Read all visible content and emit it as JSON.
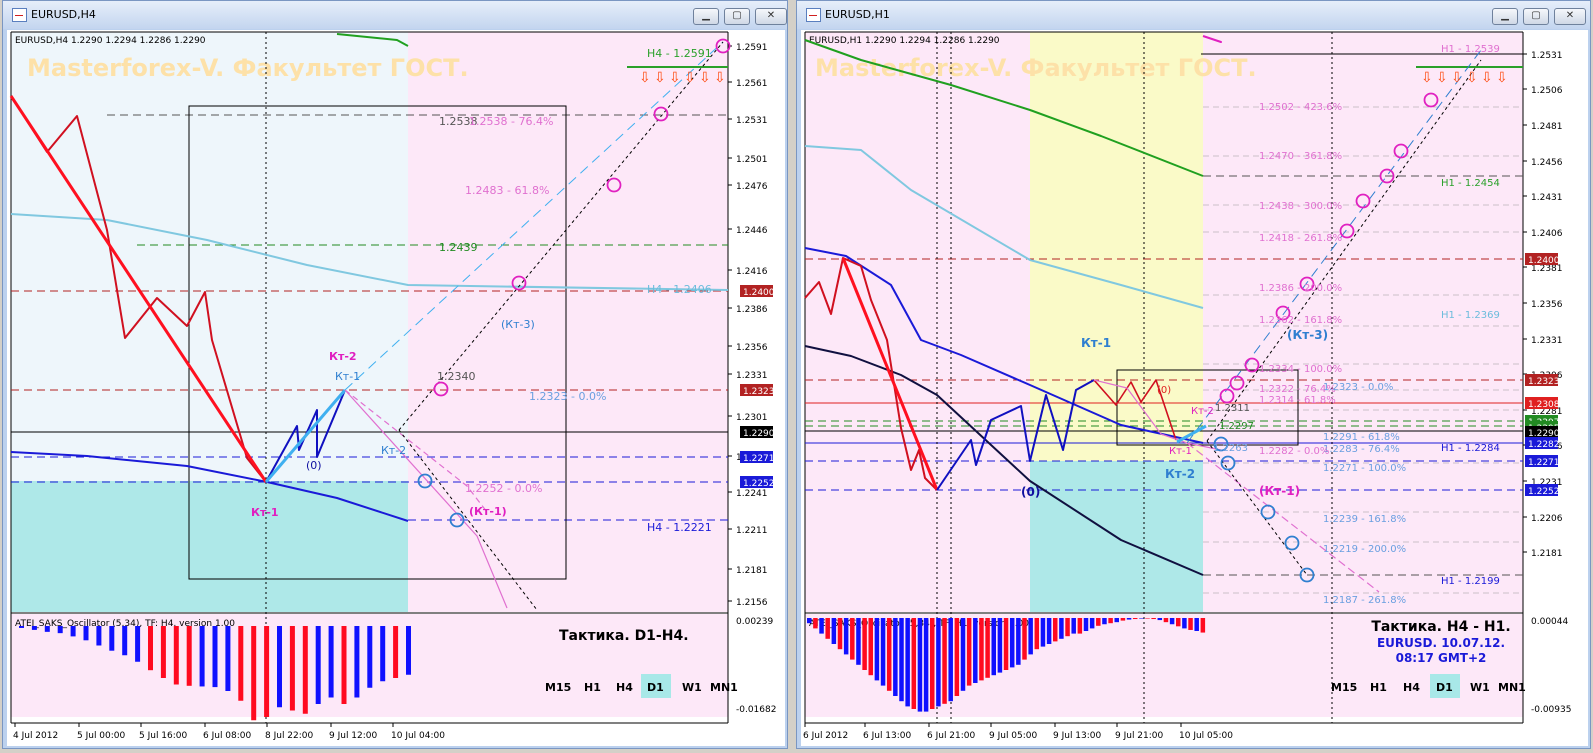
{
  "windows": [
    {
      "title": "EURUSD,H4",
      "info": "EURUSD,H4  1.2290 1.2294 1.2286 1.2290",
      "watermark": "Masterforex-V. Факультет ГОСТ.",
      "price_ticks": [
        "1.2591",
        "1.2561",
        "1.2531",
        "1.2501",
        "1.2476",
        "1.2446",
        "1.2416",
        "1.2386",
        "1.2356",
        "1.2331",
        "1.2301",
        "1.2271",
        "1.2241",
        "1.2211",
        "1.2181",
        "1.2156"
      ],
      "price_tags": [
        {
          "text": "1.2400",
          "color": "#b22222"
        },
        {
          "text": "1.2323",
          "color": "#b22222"
        },
        {
          "text": "1.2290",
          "color": "#000000"
        },
        {
          "text": "1.2271",
          "color": "#1a1ad8"
        },
        {
          "text": "1.2252",
          "color": "#1a1ad8"
        }
      ],
      "chart_labels": [
        {
          "key": "h4_2591",
          "text": "H4 - 1.2591",
          "color": "#2aa02a"
        },
        {
          "key": "l2538",
          "text": "1.2538",
          "color": "#555555"
        },
        {
          "key": "l2538f",
          "text": "1.2538 - 76.4%",
          "color": "#e070d0"
        },
        {
          "key": "l2483",
          "text": "1.2483 - 61.8%",
          "color": "#e070d0"
        },
        {
          "key": "l2439",
          "text": "1.2439",
          "color": "#228b22"
        },
        {
          "key": "h4_2406",
          "text": "H4 - 1.2406",
          "color": "#6cbcdc"
        },
        {
          "key": "kt3",
          "text": "(Кт-3)",
          "color": "#2f7fd0"
        },
        {
          "key": "kt2",
          "text": "Кт-2",
          "color": "#e020c0"
        },
        {
          "key": "kt1b",
          "text": "Кт-1",
          "color": "#2f7fd0"
        },
        {
          "key": "l2340",
          "text": "1.2340",
          "color": "#555555"
        },
        {
          "key": "l2323",
          "text": "1.2323 - 0.0%",
          "color": "#6a9fe0"
        },
        {
          "key": "kt2b",
          "text": "Кт-2",
          "color": "#2f7fd0"
        },
        {
          "key": "zero",
          "text": "(0)",
          "color": "#1010a0"
        },
        {
          "key": "l2252",
          "text": "1.2252 - 0.0%",
          "color": "#e070d0"
        },
        {
          "key": "kt1p",
          "text": "(Кт-1)",
          "color": "#e020c0"
        },
        {
          "key": "kt1m",
          "text": "Кт-1",
          "color": "#e020c0"
        },
        {
          "key": "h4_2221",
          "text": "H4 - 1.2221",
          "color": "#1a1ad8"
        }
      ],
      "osc_label": "ATEI_SAKS_Oscillator (5,34), TF: H4, version 1.00",
      "osc_ticks": [
        "0.00239",
        "-0.01682"
      ],
      "tactic_lines": [
        "Тактика. D1-H4."
      ],
      "timeframes": [
        "M15",
        "H1",
        "H4",
        "D1",
        "W1",
        "MN1"
      ],
      "active_tf": "D1",
      "time_ticks": [
        "4 Jul 2012",
        "5 Jul 00:00",
        "5 Jul 16:00",
        "6 Jul 08:00",
        "8 Jul 22:00",
        "9 Jul 12:00",
        "10 Jul 04:00"
      ],
      "osc_bars": [
        {
          "v": -0.3,
          "c": "blue"
        },
        {
          "v": -0.6,
          "c": "blue"
        },
        {
          "v": -0.9,
          "c": "blue"
        },
        {
          "v": -1.1,
          "c": "blue"
        },
        {
          "v": -1.6,
          "c": "blue"
        },
        {
          "v": -2.2,
          "c": "blue"
        },
        {
          "v": -3.0,
          "c": "blue"
        },
        {
          "v": -3.8,
          "c": "blue"
        },
        {
          "v": -4.5,
          "c": "blue"
        },
        {
          "v": -5.5,
          "c": "blue"
        },
        {
          "v": -6.8,
          "c": "red"
        },
        {
          "v": -8.0,
          "c": "red"
        },
        {
          "v": -9.0,
          "c": "red"
        },
        {
          "v": -9.2,
          "c": "red"
        },
        {
          "v": -9.3,
          "c": "blue"
        },
        {
          "v": -9.4,
          "c": "blue"
        },
        {
          "v": -10.0,
          "c": "blue"
        },
        {
          "v": -11.5,
          "c": "red"
        },
        {
          "v": -14.5,
          "c": "red"
        },
        {
          "v": -14.0,
          "c": "red"
        },
        {
          "v": -12.5,
          "c": "blue"
        },
        {
          "v": -13.0,
          "c": "red"
        },
        {
          "v": -13.5,
          "c": "red"
        },
        {
          "v": -12.0,
          "c": "blue"
        },
        {
          "v": -11.0,
          "c": "blue"
        },
        {
          "v": -12.0,
          "c": "red"
        },
        {
          "v": -11.0,
          "c": "blue"
        },
        {
          "v": -9.5,
          "c": "blue"
        },
        {
          "v": -8.5,
          "c": "blue"
        },
        {
          "v": -8.0,
          "c": "red"
        },
        {
          "v": -7.5,
          "c": "blue"
        }
      ]
    },
    {
      "title": "EURUSD,H1",
      "info": "EURUSD,H1  1.2290 1.2294 1.2286 1.2290",
      "watermark": "Masterforex-V. Факультет ГОСТ.",
      "price_ticks": [
        "1.2531",
        "1.2506",
        "1.2481",
        "1.2456",
        "1.2431",
        "1.2406",
        "1.2381",
        "1.2356",
        "1.2331",
        "1.2306",
        "1.2281",
        "1.2256",
        "1.2231",
        "1.2206",
        "1.2181"
      ],
      "price_tags": [
        {
          "text": "1.2400",
          "color": "#b22222"
        },
        {
          "text": "1.2323",
          "color": "#b22222"
        },
        {
          "text": "1.2308",
          "color": "#e02020"
        },
        {
          "text": "1.2297",
          "color": "#228b22"
        },
        {
          "text": "1.2295",
          "color": "#228b22"
        },
        {
          "text": "1.2290",
          "color": "#000000"
        },
        {
          "text": "1.2282",
          "color": "#1a1ad8"
        },
        {
          "text": "1.2271",
          "color": "#1a1ad8"
        },
        {
          "text": "1.2252",
          "color": "#1a1ad8"
        }
      ],
      "chart_labels": [
        {
          "key": "h1_2539",
          "text": "H1 - 1.2539",
          "color": "#e070d0"
        },
        {
          "key": "f4236",
          "text": "1.2502 - 423.6%",
          "color": "#e070d0"
        },
        {
          "key": "f3618",
          "text": "1.2470 - 361.8%",
          "color": "#e070d0"
        },
        {
          "key": "h1_2454",
          "text": "H1 - 1.2454",
          "color": "#2aa02a"
        },
        {
          "key": "f300",
          "text": "1.2438 - 300.0%",
          "color": "#e070d0"
        },
        {
          "key": "f2618",
          "text": "1.2418 - 261.8%",
          "color": "#e070d0"
        },
        {
          "key": "f200",
          "text": "1.2386 - 200.0%",
          "color": "#e070d0"
        },
        {
          "key": "h1_2369",
          "text": "H1 - 1.2369",
          "color": "#6cbcdc"
        },
        {
          "key": "f1618",
          "text": "1.2362 - 161.8%",
          "color": "#e070d0"
        },
        {
          "key": "kt3",
          "text": "(Кт-3)",
          "color": "#2f7fd0"
        },
        {
          "key": "kt1",
          "text": "Кт-1",
          "color": "#2f7fd0"
        },
        {
          "key": "f100",
          "text": "1.2334 - 100.0%",
          "color": "#e070d0"
        },
        {
          "key": "zero2",
          "text": "(0)",
          "color": "#e02020"
        },
        {
          "key": "f764",
          "text": "1.2322 - 76.4%",
          "color": "#e070d0"
        },
        {
          "key": "f00",
          "text": "1.2323 - 0.0%",
          "color": "#6a9fe0"
        },
        {
          "key": "f618",
          "text": "1.2314 - 61.8%",
          "color": "#e070d0"
        },
        {
          "key": "l2311",
          "text": "1.2311",
          "color": "#555555"
        },
        {
          "key": "kt2m",
          "text": "Кт-2",
          "color": "#e020c0"
        },
        {
          "key": "l2297",
          "text": "1.2297",
          "color": "#228b22"
        },
        {
          "key": "b618",
          "text": "1.2291 - 61.8%",
          "color": "#6a9fe0"
        },
        {
          "key": "h1_2284",
          "text": "H1 - 1.2284",
          "color": "#1a1ad8"
        },
        {
          "key": "b764",
          "text": "1.2283 - 76.4%",
          "color": "#6a9fe0"
        },
        {
          "key": "f00b",
          "text": "1.2282 - 0.0%",
          "color": "#e070d0"
        },
        {
          "key": "kt1m",
          "text": "Кт-1",
          "color": "#e020c0"
        },
        {
          "key": "l2263",
          "text": "1.2263",
          "color": "#6a9fe0"
        },
        {
          "key": "b100",
          "text": "1.2271 - 100.0%",
          "color": "#6a9fe0"
        },
        {
          "key": "kt2",
          "text": "Кт-2",
          "color": "#2f7fd0"
        },
        {
          "key": "kt1p",
          "text": "(Кт-1)",
          "color": "#e020c0"
        },
        {
          "key": "zero",
          "text": "(0)",
          "color": "#1010a0"
        },
        {
          "key": "b1618",
          "text": "1.2239 - 161.8%",
          "color": "#6a9fe0"
        },
        {
          "key": "b200",
          "text": "1.2219 - 200.0%",
          "color": "#6a9fe0"
        },
        {
          "key": "h1_2199",
          "text": "H1 - 1.2199",
          "color": "#1a1ad8"
        },
        {
          "key": "b2618",
          "text": "1.2187 - 261.8%",
          "color": "#6a9fe0"
        }
      ],
      "osc_label": "ATEI_SAKS_Oscillator (5,34), TF: H1, version 1.00",
      "osc_ticks": [
        "0.00044",
        "-0.00935"
      ],
      "tactic_lines": [
        "Тактика. H4 - H1.",
        "EURUSD. 10.07.12.",
        "08:17  GMT+2"
      ],
      "timeframes": [
        "M15",
        "H1",
        "H4",
        "D1",
        "W1",
        "MN1"
      ],
      "active_tf": "D1",
      "time_ticks": [
        "6 Jul 2012",
        "6 Jul 13:00",
        "6 Jul 21:00",
        "9 Jul 05:00",
        "9 Jul 13:00",
        "9 Jul 21:00",
        "10 Jul 05:00"
      ],
      "osc_bars": [
        {
          "v": -1,
          "c": "blue"
        },
        {
          "v": -2,
          "c": "red"
        },
        {
          "v": -3,
          "c": "blue"
        },
        {
          "v": -4,
          "c": "red"
        },
        {
          "v": -5,
          "c": "blue"
        },
        {
          "v": -6,
          "c": "red"
        },
        {
          "v": -7,
          "c": "blue"
        },
        {
          "v": -8,
          "c": "red"
        },
        {
          "v": -9,
          "c": "blue"
        },
        {
          "v": -10,
          "c": "red"
        },
        {
          "v": -11,
          "c": "red"
        },
        {
          "v": -12,
          "c": "blue"
        },
        {
          "v": -13,
          "c": "blue"
        },
        {
          "v": -14,
          "c": "red"
        },
        {
          "v": -15,
          "c": "blue"
        },
        {
          "v": -16,
          "c": "blue"
        },
        {
          "v": -17,
          "c": "blue"
        },
        {
          "v": -17.5,
          "c": "red"
        },
        {
          "v": -18,
          "c": "blue"
        },
        {
          "v": -18,
          "c": "blue"
        },
        {
          "v": -17.5,
          "c": "red"
        },
        {
          "v": -17,
          "c": "blue"
        },
        {
          "v": -16.5,
          "c": "red"
        },
        {
          "v": -16,
          "c": "blue"
        },
        {
          "v": -15,
          "c": "red"
        },
        {
          "v": -14,
          "c": "blue"
        },
        {
          "v": -13,
          "c": "red"
        },
        {
          "v": -12.5,
          "c": "blue"
        },
        {
          "v": -12,
          "c": "red"
        },
        {
          "v": -11.5,
          "c": "red"
        },
        {
          "v": -11,
          "c": "blue"
        },
        {
          "v": -10.5,
          "c": "blue"
        },
        {
          "v": -10,
          "c": "red"
        },
        {
          "v": -9.5,
          "c": "blue"
        },
        {
          "v": -9,
          "c": "blue"
        },
        {
          "v": -8,
          "c": "red"
        },
        {
          "v": -7,
          "c": "blue"
        },
        {
          "v": -6,
          "c": "red"
        },
        {
          "v": -5.5,
          "c": "blue"
        },
        {
          "v": -5,
          "c": "blue"
        },
        {
          "v": -4.5,
          "c": "red"
        },
        {
          "v": -4,
          "c": "blue"
        },
        {
          "v": -3.5,
          "c": "red"
        },
        {
          "v": -3,
          "c": "blue"
        },
        {
          "v": -3,
          "c": "red"
        },
        {
          "v": -2.5,
          "c": "blue"
        },
        {
          "v": -2,
          "c": "blue"
        },
        {
          "v": -1.5,
          "c": "red"
        },
        {
          "v": -1.2,
          "c": "blue"
        },
        {
          "v": -1,
          "c": "red"
        },
        {
          "v": -0.8,
          "c": "blue"
        },
        {
          "v": -0.5,
          "c": "red"
        },
        {
          "v": -0.3,
          "c": "blue"
        },
        {
          "v": -0.2,
          "c": "red"
        },
        {
          "v": -0.1,
          "c": "blue"
        },
        {
          "v": -0.1,
          "c": "red"
        },
        {
          "v": -0.2,
          "c": "red"
        },
        {
          "v": -0.4,
          "c": "blue"
        },
        {
          "v": -0.8,
          "c": "red"
        },
        {
          "v": -1.2,
          "c": "blue"
        },
        {
          "v": -1.6,
          "c": "red"
        },
        {
          "v": -2.0,
          "c": "blue"
        },
        {
          "v": -2.3,
          "c": "red"
        },
        {
          "v": -2.5,
          "c": "blue"
        },
        {
          "v": -2.8,
          "c": "red"
        }
      ]
    }
  ],
  "chart_data": [
    {
      "type": "line",
      "title": "EURUSD,H4",
      "x": [
        "4 Jul 2012",
        "5 Jul 00:00",
        "5 Jul 16:00",
        "6 Jul 08:00",
        "8 Jul 22:00",
        "9 Jul 12:00",
        "10 Jul 04:00"
      ],
      "ylim": [
        1.2156,
        1.2591
      ],
      "series": [],
      "levels": [
        1.2591,
        1.2538,
        1.2483,
        1.2439,
        1.2406,
        1.24,
        1.234,
        1.2323,
        1.229,
        1.2271,
        1.2252,
        1.2221
      ]
    },
    {
      "type": "line",
      "title": "EURUSD,H1",
      "x": [
        "6 Jul 2012",
        "6 Jul 13:00",
        "6 Jul 21:00",
        "9 Jul 05:00",
        "9 Jul 13:00",
        "9 Jul 21:00",
        "10 Jul 05:00"
      ],
      "ylim": [
        1.2181,
        1.2531
      ],
      "series": [],
      "levels": [
        1.2539,
        1.2502,
        1.247,
        1.2454,
        1.2438,
        1.2418,
        1.24,
        1.2386,
        1.2369,
        1.2362,
        1.2334,
        1.2323,
        1.2322,
        1.2314,
        1.2311,
        1.2308,
        1.2297,
        1.2295,
        1.2291,
        1.229,
        1.2284,
        1.2283,
        1.2282,
        1.2271,
        1.2263,
        1.2252,
        1.2239,
        1.2219,
        1.2199,
        1.2187
      ]
    }
  ]
}
